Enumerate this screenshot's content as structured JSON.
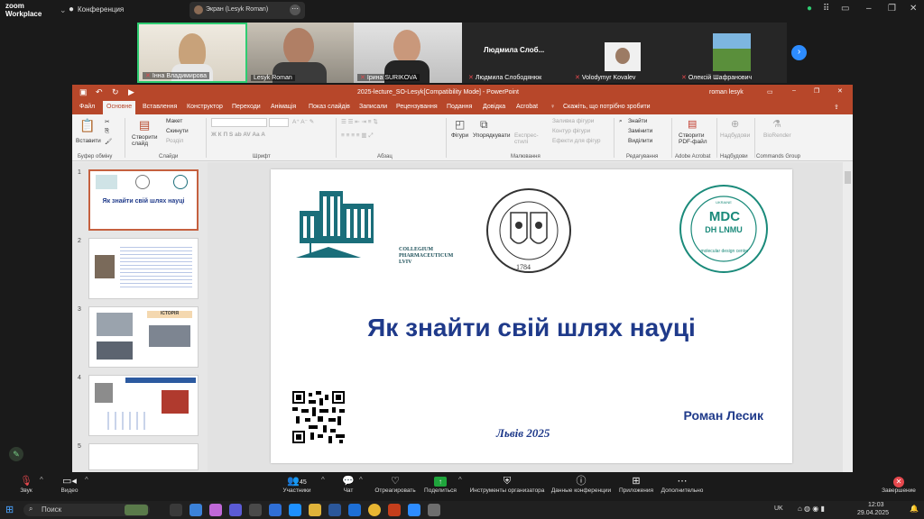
{
  "zoom": {
    "logo_line1": "zoom",
    "logo_line2": "Workplace",
    "meeting_label": "Конференция",
    "screen_share_label": "Экран (Lesyk Roman)",
    "more_label": "···"
  },
  "participants": [
    {
      "name": "Інна Владимирова",
      "muted": true
    },
    {
      "name": "Lesyk Roman",
      "muted": false
    },
    {
      "name": "Ірина SURIKOVA",
      "muted": true
    },
    {
      "name": "Людмила Слободянюк",
      "big_name": "Людмила Слоб...",
      "muted": true
    },
    {
      "name": "Volodymyr Kovalev",
      "muted": true
    },
    {
      "name": "Олексій Шафранович",
      "muted": true
    }
  ],
  "ppt": {
    "title": "2025-lecture_SO-Lesyk[Compatibility Mode] - PowerPoint",
    "user": "roman lesyk",
    "tabs": [
      "Файл",
      "Основне",
      "Вставлення",
      "Конструктор",
      "Переходи",
      "Анімація",
      "Показ слайдів",
      "Записали",
      "Рецензування",
      "Подання",
      "Довідка",
      "Acrobat"
    ],
    "tell_me": "Скажіть, що потрібно зробити",
    "ribbon": {
      "paste": "Вставити",
      "clipboard_group": "Буфер обміну",
      "new_slide": "Створити слайд",
      "layout": "Макет",
      "reset": "Скинути",
      "section": "Розділ",
      "slides_group": "Слайди",
      "font_group": "Шрифт",
      "paragraph_group": "Абзац",
      "shapes": "Фігури",
      "arrange": "Упорядкувати",
      "quick_styles": "Експрес-стилі",
      "fill": "Заливка фігури",
      "outline": "Контур фігури",
      "effects": "Ефекти для фігур",
      "drawing_group": "Малювання",
      "find": "Знайти",
      "replace": "Замінити",
      "select": "Виділити",
      "editing_group": "Редагування",
      "create_pdf": "Створити PDF-файл",
      "acrobat_group": "Adobe Acrobat",
      "sign": "Надбудови",
      "addins_group": "Надбудови",
      "biorender": "BioRender",
      "commands_group": "Commands Group"
    },
    "slide_numbers": [
      "1",
      "2",
      "3",
      "4",
      "5"
    ],
    "slide": {
      "title": "Як знайти свій шлях науці",
      "author": "Роман Лесик",
      "city_year": "Львів 2025",
      "logo1_text1": "COLLEGIUM",
      "logo1_text2": "PHARMACEUTICUM",
      "logo1_text3": "LVIV",
      "logo2_year": "1784",
      "logo3_text1": "MDC",
      "logo3_text2": "DH LNMU",
      "logo3_text3": "molecular design center",
      "logo3_text4": "UKRAINE"
    },
    "thumb1_title": "Як знайти свій шлях науці",
    "thumb3_heading": "ІСТОРІЯ"
  },
  "toolbar": {
    "audio": "Звук",
    "video": "Видео",
    "participants": "Участники",
    "participants_count": "45",
    "chat": "Чат",
    "react": "Отреагировать",
    "share": "Поделиться",
    "host_tools": "Инструменты организатора",
    "meeting_data": "Данные конференции",
    "apps": "Приложения",
    "more": "Дополнительно",
    "end": "Завершение"
  },
  "taskbar": {
    "search": "Поиск",
    "lang": "UK",
    "time": "12:03",
    "date": "29.04.2025"
  },
  "colors": {
    "ppt_accent": "#b7472a",
    "slide_text": "#1f3a8a",
    "logo_teal": "#1a6e7a"
  }
}
